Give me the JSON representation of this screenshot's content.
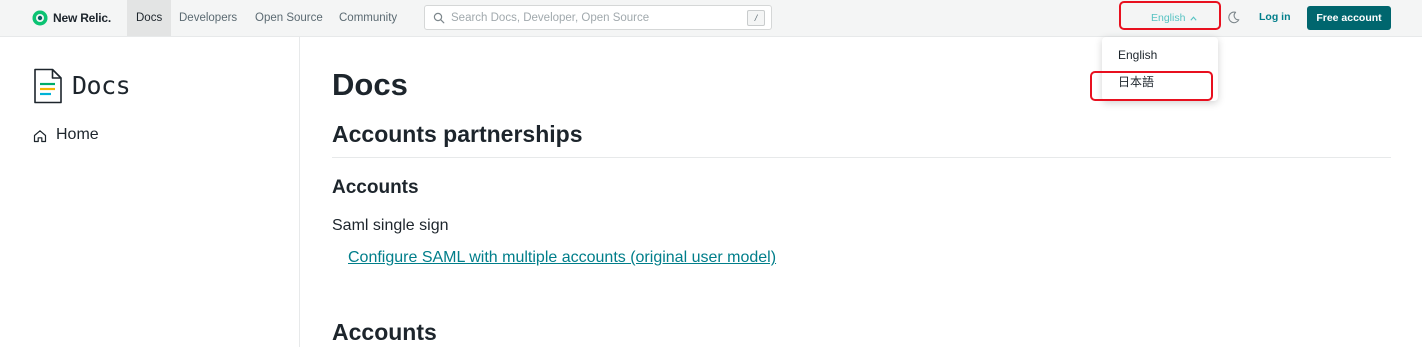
{
  "header": {
    "brand": "New Relic.",
    "nav": [
      "Docs",
      "Developers",
      "Open Source",
      "Community"
    ],
    "search": {
      "placeholder": "Search Docs, Developer, Open Source",
      "shortcut": "/"
    },
    "language": "English",
    "login": "Log in",
    "cta": "Free account"
  },
  "language_menu": {
    "items": [
      "English",
      "日本語"
    ]
  },
  "sidebar": {
    "title": "Docs",
    "home": "Home"
  },
  "main": {
    "title": "Docs",
    "section": "Accounts partnerships",
    "subsection": "Accounts",
    "topic": "Saml single sign",
    "link": "Configure SAML with multiple accounts (original user model)",
    "next_section": "Accounts"
  },
  "colors": {
    "accent": "#007e8a",
    "cta": "#00666e",
    "highlight": "#e8101f",
    "language_text": "#58c3c3"
  }
}
